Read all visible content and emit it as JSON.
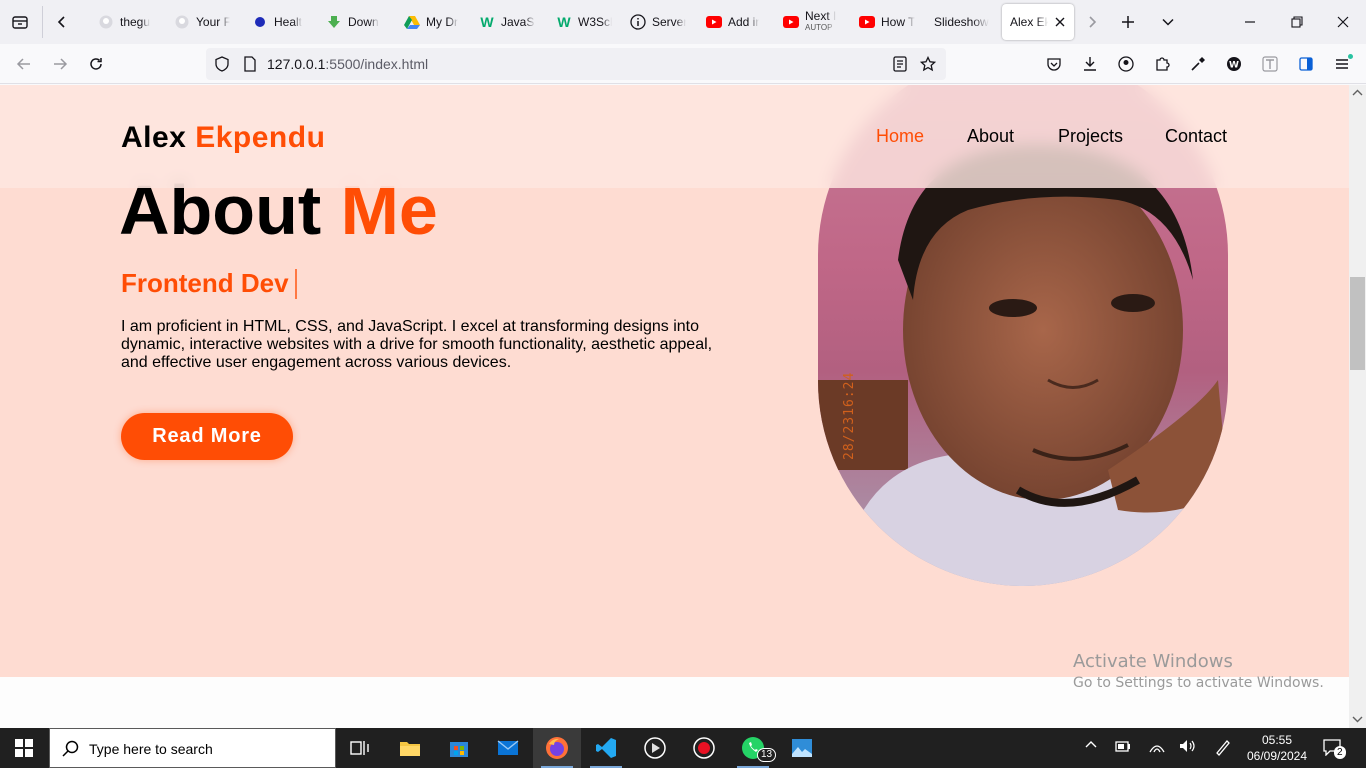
{
  "browser": {
    "tabs": [
      {
        "label": "thegu",
        "icon": "github-icon"
      },
      {
        "label": "Your F",
        "icon": "github-icon"
      },
      {
        "label": "Healt",
        "icon": "circle-icon"
      },
      {
        "label": "Down",
        "icon": "download-icon"
      },
      {
        "label": "My Dr",
        "icon": "google-drive-icon"
      },
      {
        "label": "JavaSc",
        "icon": "w3schools-icon"
      },
      {
        "label": "W3Sch",
        "icon": "w3schools-icon"
      },
      {
        "label": "Server",
        "icon": "info-icon"
      },
      {
        "label": "Add ir",
        "icon": "youtube-icon"
      },
      {
        "label": "Next I",
        "sublabel": "AUTOP",
        "icon": "youtube-icon"
      },
      {
        "label": "How T",
        "icon": "youtube-icon"
      },
      {
        "label": "Slideshow",
        "icon": ""
      },
      {
        "label": "Alex Ek",
        "icon": "",
        "active": true
      }
    ],
    "url_host": "127.0.0.1",
    "url_rest": ":5500/index.html"
  },
  "page": {
    "logo": {
      "first": "Alex",
      "last": "Ekpendu"
    },
    "nav": {
      "home": "Home",
      "about": "About",
      "projects": "Projects",
      "contact": "Contact"
    },
    "title": {
      "first": "About",
      "accent": "Me"
    },
    "subtitle": "Frontend Dev",
    "description": "I am proficient in HTML, CSS, and JavaScript. I excel at transforming designs into dynamic, interactive websites with a drive for smooth functionality, aesthetic appeal, and effective user engagement across various devices.",
    "read_more": "Read More",
    "photo_stamp": "28/2316:24",
    "colors": {
      "accent": "#ff4d05",
      "background": "#fedcd2"
    }
  },
  "watermark": {
    "line1": "Activate Windows",
    "line2": "Go to Settings to activate Windows."
  },
  "taskbar": {
    "search_placeholder": "Type here to search",
    "time": "05:55",
    "date": "06/09/2024",
    "whatsapp_badge": "13",
    "notifications": "2"
  }
}
